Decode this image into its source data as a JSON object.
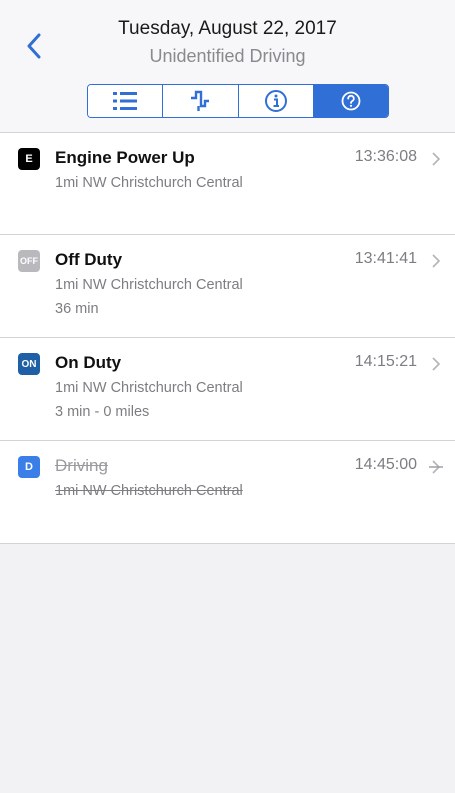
{
  "header": {
    "date": "Tuesday, August 22, 2017",
    "subtitle": "Unidentified Driving",
    "tabs": [
      {
        "icon": "list-icon",
        "active": false
      },
      {
        "icon": "graph-icon",
        "active": false
      },
      {
        "icon": "info-icon",
        "active": false
      },
      {
        "icon": "help-icon",
        "active": true
      }
    ]
  },
  "colors": {
    "accent": "#2f6fd6",
    "engine_badge": "#000000",
    "off_duty_badge": "#b9b9bd",
    "on_duty_badge": "#1f5fa6",
    "driving_badge": "#3a7ee8"
  },
  "events": [
    {
      "badge": "E",
      "title": "Engine Power Up",
      "time": "13:36:08",
      "location": "1mi NW Christchurch Central",
      "detail": ""
    },
    {
      "badge": "OFF",
      "title": "Off Duty",
      "time": "13:41:41",
      "location": "1mi NW Christchurch Central",
      "detail": "36 min"
    },
    {
      "badge": "ON",
      "title": "On Duty",
      "time": "14:15:21",
      "location": "1mi NW Christchurch Central",
      "detail": "3 min - 0 miles"
    },
    {
      "badge": "D",
      "title": "Driving",
      "time": "14:45:00",
      "location": "1mi NW Christchurch Central",
      "detail": "",
      "struck": true
    }
  ]
}
